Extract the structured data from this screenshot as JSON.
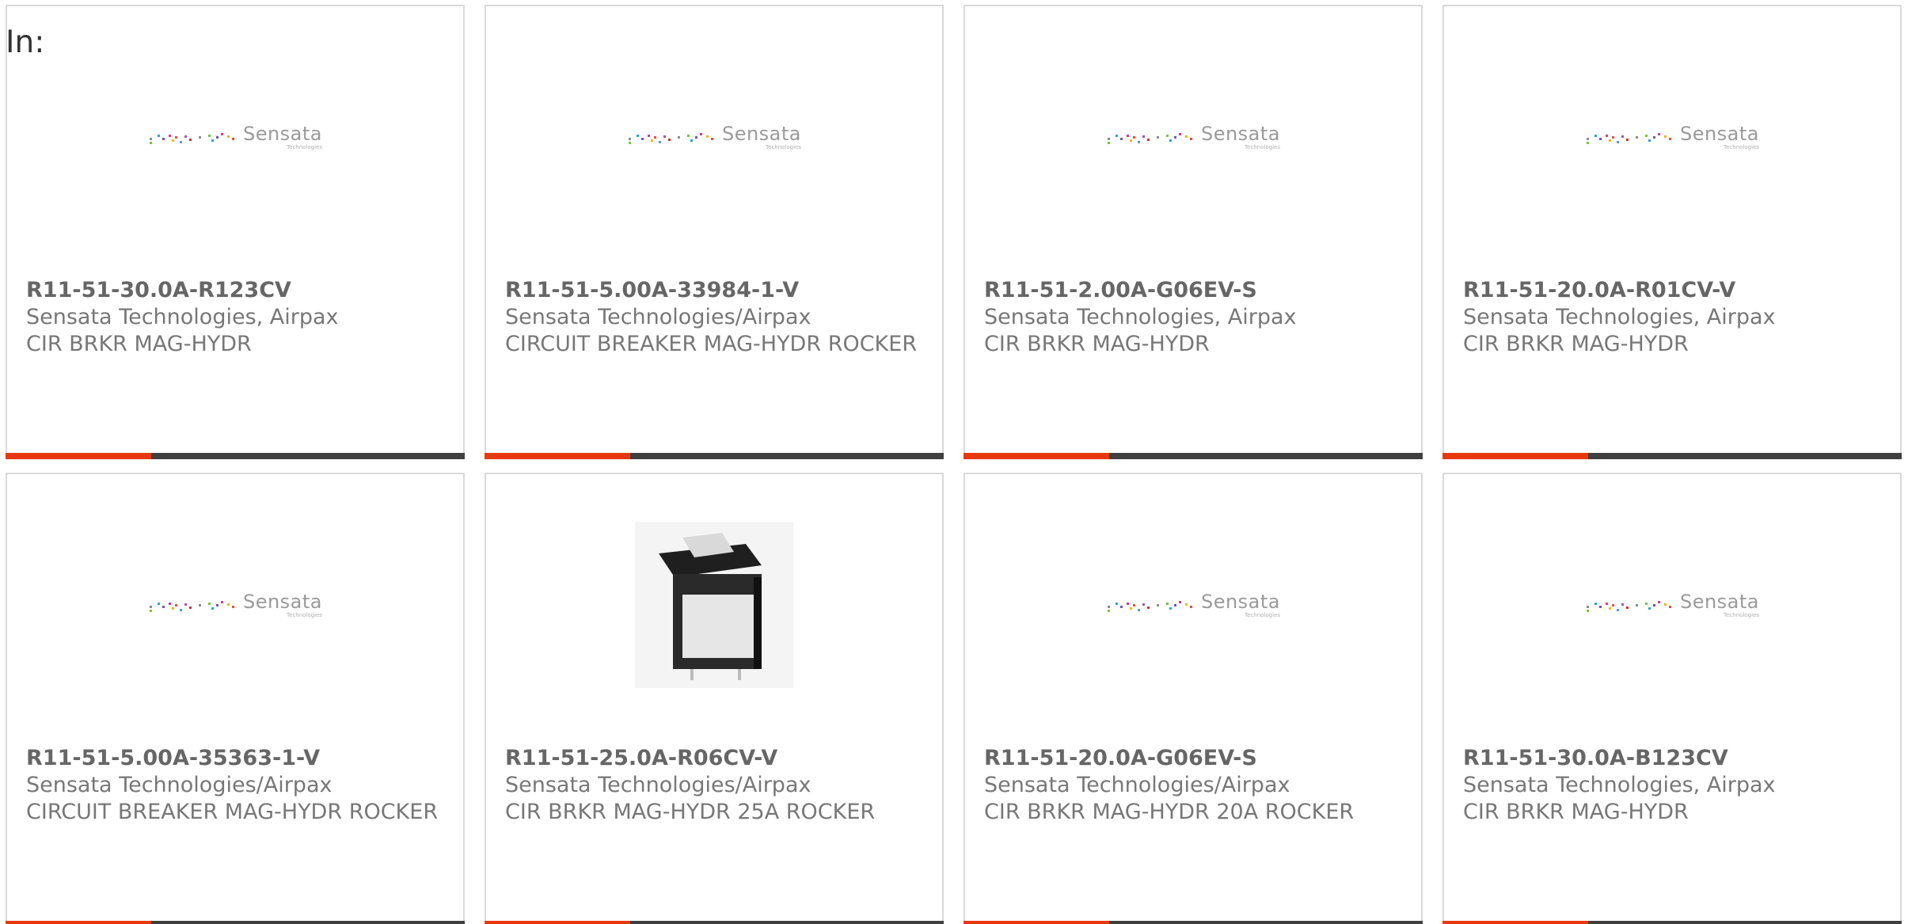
{
  "filter": {
    "label": "In:"
  },
  "logo": {
    "name": "Sensata",
    "sub": "Technologies"
  },
  "colors": {
    "accent": "#e8390e",
    "bar": "#404040",
    "border": "#d9d9d9"
  },
  "products": [
    {
      "part_number": "R11-51-30.0A-R123CV",
      "manufacturer": "Sensata Technologies, Airpax",
      "description": "CIR BRKR MAG-HYDR",
      "image": "sensata-logo"
    },
    {
      "part_number": "R11-51-5.00A-33984-1-V",
      "manufacturer": "Sensata Technologies/Airpax",
      "description": "CIRCUIT BREAKER MAG-HYDR ROCKER",
      "image": "sensata-logo"
    },
    {
      "part_number": "R11-51-2.00A-G06EV-S",
      "manufacturer": "Sensata Technologies, Airpax",
      "description": "CIR BRKR MAG-HYDR",
      "image": "sensata-logo"
    },
    {
      "part_number": "R11-51-20.0A-R01CV-V",
      "manufacturer": "Sensata Technologies, Airpax",
      "description": "CIR BRKR MAG-HYDR",
      "image": "sensata-logo"
    },
    {
      "part_number": "R11-51-5.00A-35363-1-V",
      "manufacturer": "Sensata Technologies/Airpax",
      "description": "CIRCUIT BREAKER MAG-HYDR ROCKER",
      "image": "sensata-logo"
    },
    {
      "part_number": "R11-51-25.0A-R06CV-V",
      "manufacturer": "Sensata Technologies/Airpax",
      "description": "CIR BRKR MAG-HYDR 25A ROCKER",
      "image": "rocker-breaker-photo"
    },
    {
      "part_number": "R11-51-20.0A-G06EV-S",
      "manufacturer": "Sensata Technologies/Airpax",
      "description": "CIR BRKR MAG-HYDR 20A ROCKER",
      "image": "sensata-logo"
    },
    {
      "part_number": "R11-51-30.0A-B123CV",
      "manufacturer": "Sensata Technologies, Airpax",
      "description": "CIR BRKR MAG-HYDR",
      "image": "sensata-logo"
    }
  ]
}
